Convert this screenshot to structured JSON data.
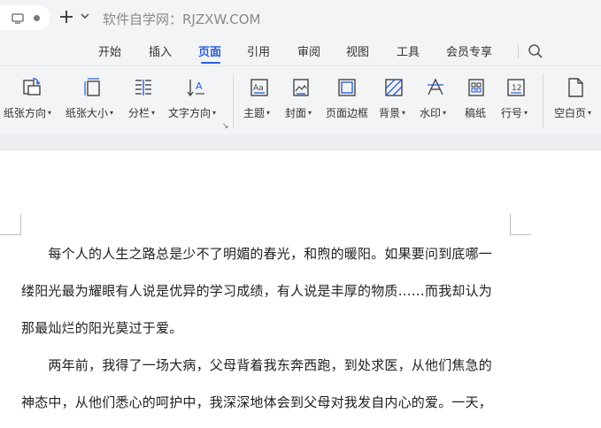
{
  "titlebar": {
    "site_title": "软件自学网：RJZXW.COM"
  },
  "menu": {
    "tabs": [
      {
        "label": "开始",
        "active": false
      },
      {
        "label": "插入",
        "active": false
      },
      {
        "label": "页面",
        "active": true
      },
      {
        "label": "引用",
        "active": false
      },
      {
        "label": "审阅",
        "active": false
      },
      {
        "label": "视图",
        "active": false
      },
      {
        "label": "工具",
        "active": false
      },
      {
        "label": "会员专享",
        "active": false
      }
    ]
  },
  "ribbon": {
    "tools": [
      {
        "label": "纸张方向",
        "icon": "paper-orientation-icon",
        "dropdown": true
      },
      {
        "label": "纸张大小",
        "icon": "paper-size-icon",
        "dropdown": true
      },
      {
        "label": "分栏",
        "icon": "columns-icon",
        "dropdown": true
      },
      {
        "label": "文字方向",
        "icon": "text-direction-icon",
        "dropdown": true
      },
      {
        "label": "主题",
        "icon": "theme-icon",
        "dropdown": true
      },
      {
        "label": "封面",
        "icon": "cover-icon",
        "dropdown": true
      },
      {
        "label": "页面边框",
        "icon": "page-border-icon",
        "dropdown": false
      },
      {
        "label": "背景",
        "icon": "background-icon",
        "dropdown": true
      },
      {
        "label": "水印",
        "icon": "watermark-icon",
        "dropdown": true
      },
      {
        "label": "稿纸",
        "icon": "manuscript-icon",
        "dropdown": false
      },
      {
        "label": "行号",
        "icon": "line-number-icon",
        "dropdown": true
      },
      {
        "label": "空白页",
        "icon": "blank-page-icon",
        "dropdown": true
      }
    ],
    "theme_icon_text": "Aa",
    "line_number_icon_text": "12"
  },
  "document": {
    "lines": [
      "　　每个人的人生之路总是少不了明媚的春光，和煦的暖阳。如果要问到底哪一",
      "缕阳光最为耀眼有人说是优异的学习成绩，有人说是丰厚的物质……而我却认为",
      "那最灿烂的阳光莫过于爱。",
      "　　两年前，我得了一场大病，父母背着我东奔西跑，到处求医，从他们焦急的",
      "神态中，从他们悉心的呵护中，我深深地体会到父母对我发自内心的爱。一天，"
    ]
  },
  "colors": {
    "accent": "#2b5fd9",
    "toolbar_bg": "#f3f4f6"
  }
}
